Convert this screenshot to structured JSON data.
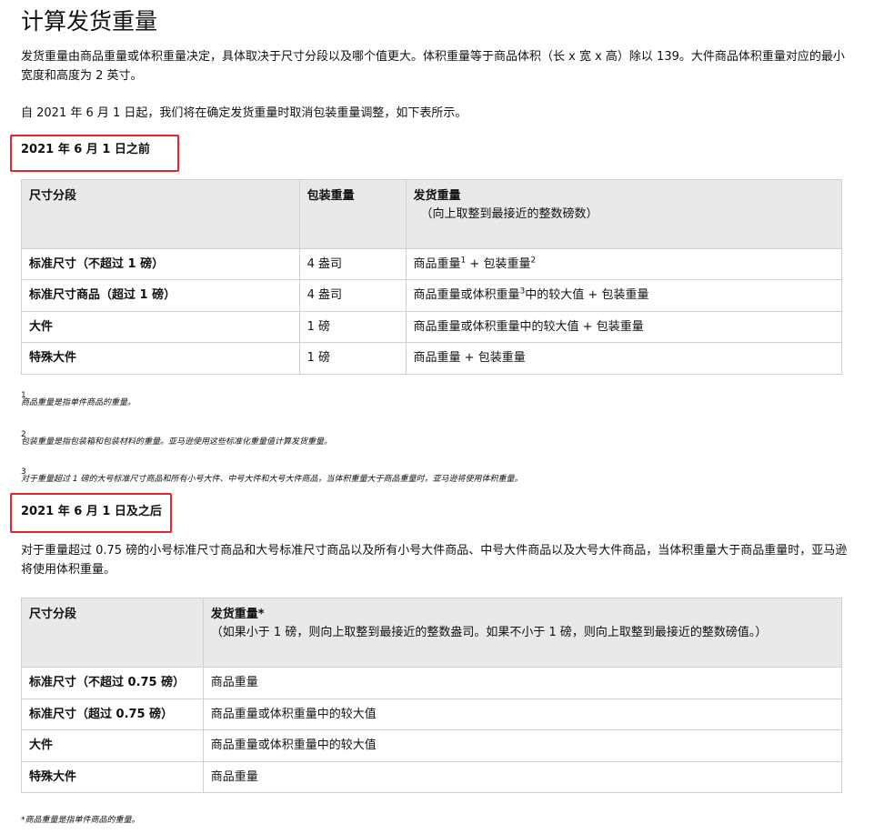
{
  "title": "计算发货重量",
  "intro": "发货重量由商品重量或体积重量决定，具体取决于尺寸分段以及哪个值更大。体积重量等于商品体积（长 x 宽 x 高）除以 139。大件商品体积重量对应的最小宽度和高度为 2 英寸。",
  "change_note": "自 2021 年 6 月 1 日起，我们将在确定发货重量时取消包装重量调整，如下表所示。",
  "before": {
    "heading": "2021 年 6 月 1 日之前",
    "headers": {
      "col1": "尺寸分段",
      "col2": "包装重量",
      "col3": "发货重量",
      "col3_sub": "（向上取整到最接近的整数磅数）"
    },
    "rows": [
      {
        "tier": "标准尺寸（不超过 1 磅）",
        "pkg": "4 盎司",
        "ship_a": "商品重量",
        "sup_a": "1",
        "ship_b": " + 包装重量",
        "sup_b": "2",
        "ship_c": ""
      },
      {
        "tier": "标准尺寸商品（超过 1 磅）",
        "pkg": "4 盎司",
        "ship_a": "商品重量或体积重量",
        "sup_a": "3",
        "ship_b": "中的较大值 + 包装重量",
        "sup_b": "",
        "ship_c": ""
      },
      {
        "tier": "大件",
        "pkg": "1 磅",
        "ship_a": "商品重量或体积重量中的较大值 + 包装重量",
        "sup_a": "",
        "ship_b": "",
        "sup_b": "",
        "ship_c": ""
      },
      {
        "tier": "特殊大件",
        "pkg": "1 磅",
        "ship_a": "商品重量 + 包装重量",
        "sup_a": "",
        "ship_b": "",
        "sup_b": "",
        "ship_c": ""
      }
    ],
    "footnotes": [
      {
        "num": "1",
        "text": "商品重量是指单件商品的重量。"
      },
      {
        "num": "2",
        "text": "包装重量是指包装箱和包装材料的重量。亚马逊使用这些标准化重量值计算发货重量。"
      },
      {
        "num": "3",
        "text": "对于重量超过 1 磅的大号标准尺寸商品和所有小号大件、中号大件和大号大件商品，当体积重量大于商品重量时，亚马逊将使用体积重量。"
      }
    ]
  },
  "after": {
    "heading": "2021 年 6 月 1 日及之后",
    "note": "对于重量超过 0.75 磅的小号标准尺寸商品和大号标准尺寸商品以及所有小号大件商品、中号大件商品以及大号大件商品，当体积重量大于商品重量时，亚马逊将使用体积重量。",
    "headers": {
      "col1": "尺寸分段",
      "col2": "发货重量*",
      "col2_sub": "（如果小于 1 磅，则向上取整到最接近的整数盎司。如果不小于 1 磅，则向上取整到最接近的整数磅值。）"
    },
    "rows": [
      {
        "tier": "标准尺寸（不超过 0.75 磅）",
        "ship": "商品重量"
      },
      {
        "tier": "标准尺寸（超过 0.75 磅）",
        "ship": "商品重量或体积重量中的较大值"
      },
      {
        "tier": "大件",
        "ship": "商品重量或体积重量中的较大值"
      },
      {
        "tier": "特殊大件",
        "ship": "商品重量"
      }
    ],
    "footnote": "*商品重量是指单件商品的重量。"
  },
  "colors": {
    "highlight_box": "#e8232a",
    "table_header_bg": "#e9e9e9",
    "border": "#d0d0d0"
  }
}
